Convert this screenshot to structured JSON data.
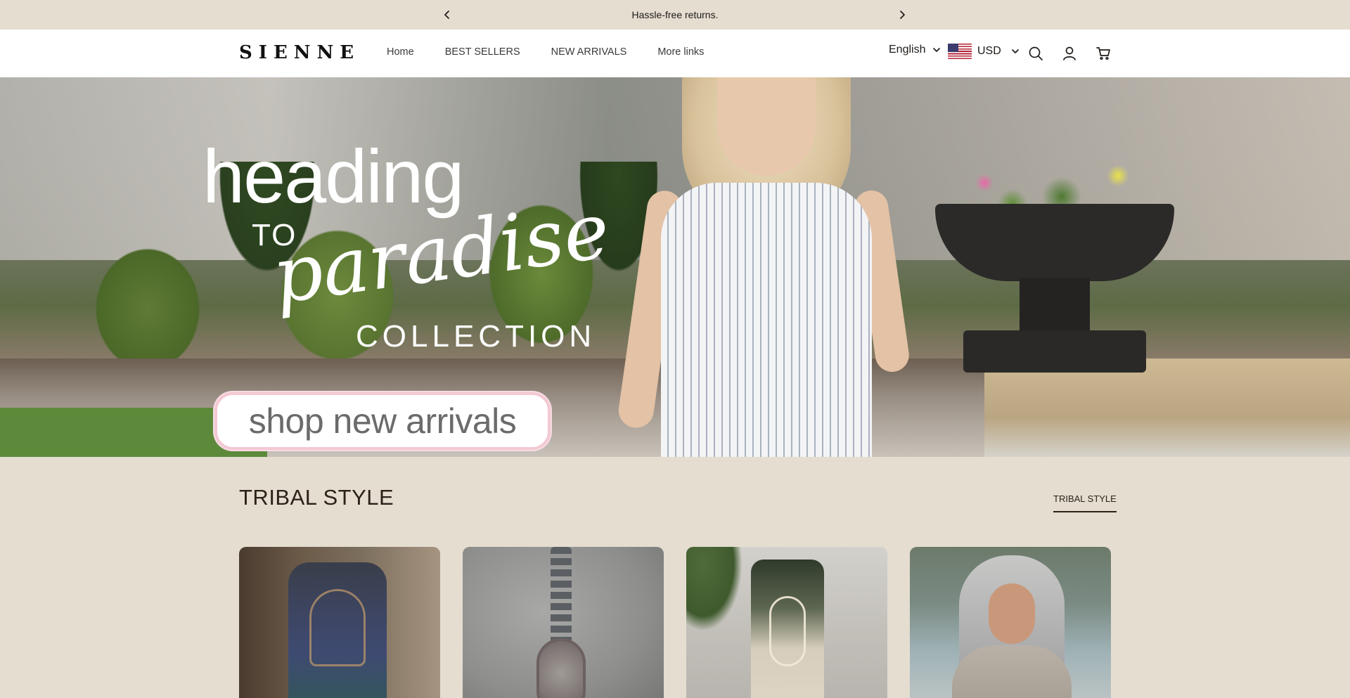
{
  "announcement": {
    "text": "Hassle-free returns."
  },
  "header": {
    "logo": "SIENNE",
    "nav": [
      {
        "label": "Home"
      },
      {
        "label": "BEST SELLERS"
      },
      {
        "label": "NEW ARRIVALS"
      },
      {
        "label": "More links"
      }
    ],
    "language": "English",
    "currency": "USD"
  },
  "hero": {
    "headline": "heading",
    "to": "TO",
    "script": "paradise",
    "collection": "COLLECTION",
    "cta": "shop new arrivals"
  },
  "collection": {
    "title": "TRIBAL STYLE",
    "link": "TRIBAL STYLE"
  },
  "colors": {
    "background": "#e4ddd0",
    "header_bg": "#ffffff",
    "text": "#2b2119",
    "cta_border": "#f3c9d4"
  }
}
